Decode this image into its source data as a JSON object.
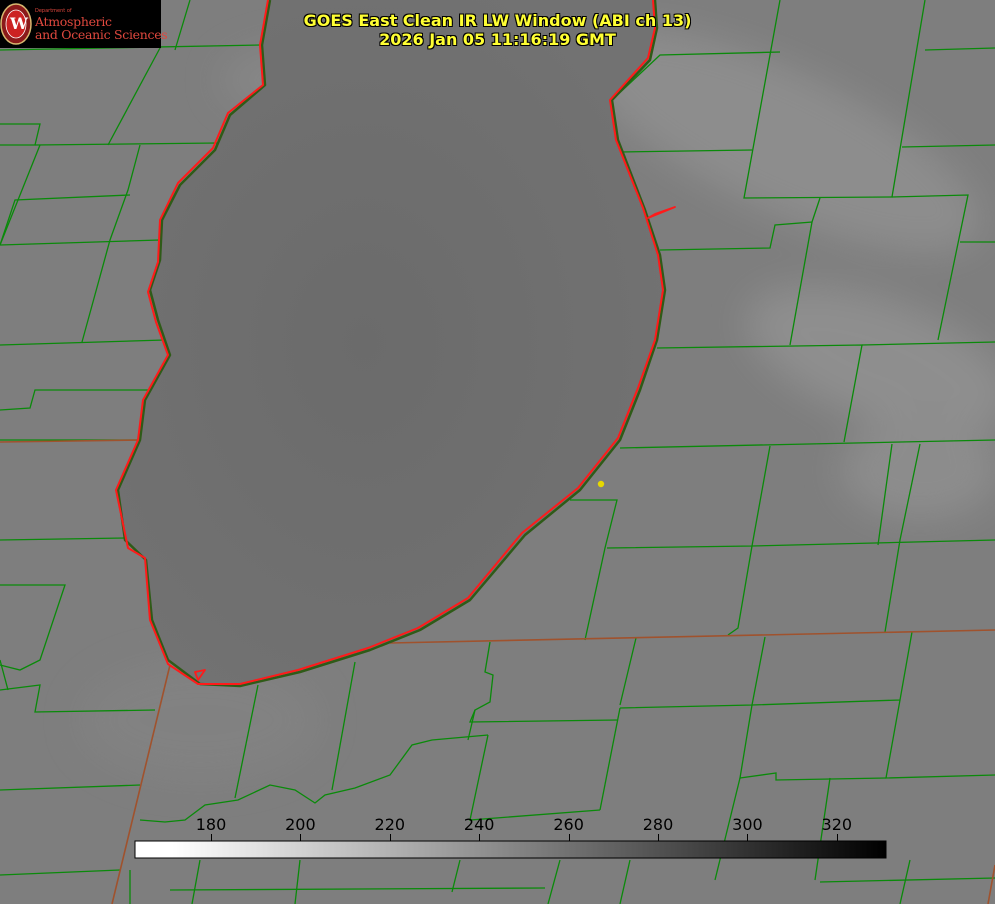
{
  "title": {
    "line1": "GOES East Clean IR LW Window (ABI ch 13)",
    "line2": "2026 Jan 05 11:16:19 GMT"
  },
  "logo": {
    "department": "Department of",
    "line1": "Atmospheric",
    "line2": "and Oceanic Sciences",
    "emblem_letter": "W",
    "color": "#e0483e"
  },
  "colorbar": {
    "ticks": [
      "180",
      "200",
      "220",
      "240",
      "260",
      "280",
      "300",
      "320"
    ],
    "min": 163,
    "max": 331,
    "gradient_start": "#ffffff",
    "gradient_end": "#000000"
  },
  "map": {
    "land_color": "#7f7f7f",
    "lake_color": "#6a6a6a",
    "county_border_color": "#008800",
    "coast_color": "#ff1a1a",
    "state_border_color": "#a0522d",
    "marker_color": "#e6d800"
  }
}
